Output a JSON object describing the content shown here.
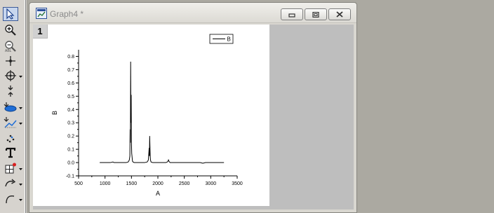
{
  "window": {
    "title": "Graph4 *"
  },
  "layer": {
    "number": "1"
  },
  "tools": [
    {
      "name": "pointer-tool",
      "icon": "pointer-arrow-icon"
    },
    {
      "name": "zoom-in-tool",
      "icon": "zoom-in-icon"
    },
    {
      "name": "zoom-out-tool",
      "icon": "zoom-out-icon"
    },
    {
      "name": "screen-reader-tool",
      "icon": "crosshair-icon"
    },
    {
      "name": "data-reader-tool",
      "icon": "target-icon"
    },
    {
      "name": "data-selector-tool",
      "icon": "selector-icon"
    },
    {
      "name": "draw-data-tool",
      "icon": "draw-data-icon"
    },
    {
      "name": "mask-points-tool",
      "icon": "mask-icon"
    },
    {
      "name": "remove-bad-data-tool",
      "icon": "scatter-dots-icon"
    },
    {
      "name": "text-tool",
      "icon": "text-icon"
    },
    {
      "name": "add-table-tool",
      "icon": "table-icon"
    },
    {
      "name": "arrow-tool",
      "icon": "curved-arrow-icon"
    },
    {
      "name": "curved-arrow-tool",
      "icon": "arc-icon"
    }
  ],
  "chart_data": {
    "type": "line",
    "xlabel": "A",
    "ylabel": "B",
    "xlim": [
      500,
      3500
    ],
    "ylim": [
      -0.1,
      0.85
    ],
    "xticks": [
      500,
      1000,
      1500,
      2000,
      2500,
      3000,
      3500
    ],
    "yticks": [
      -0.1,
      0.0,
      0.1,
      0.2,
      0.3,
      0.4,
      0.5,
      0.6,
      0.7,
      0.8
    ],
    "xtick_labels": [
      "500",
      "1000",
      "1500",
      "2000",
      "2500",
      "3000",
      "3500"
    ],
    "ytick_labels": [
      "-0.1",
      "0.0",
      "0.1",
      "0.2",
      "0.3",
      "0.4",
      "0.5",
      "0.6",
      "0.7",
      "0.8"
    ],
    "legend_position": "top-right",
    "series": [
      {
        "name": "B",
        "color": "#000000",
        "x": [
          900,
          1000,
          1100,
          1150,
          1170,
          1200,
          1300,
          1400,
          1440,
          1460,
          1470,
          1475,
          1480,
          1485,
          1490,
          1495,
          1500,
          1505,
          1510,
          1515,
          1520,
          1530,
          1550,
          1600,
          1650,
          1700,
          1750,
          1800,
          1820,
          1835,
          1840,
          1845,
          1850,
          1855,
          1860,
          1870,
          1900,
          1950,
          2000,
          2100,
          2150,
          2180,
          2190,
          2200,
          2210,
          2230,
          2300,
          2400,
          2500,
          2600,
          2700,
          2800,
          2850,
          2900,
          2950,
          3000,
          3100,
          3200,
          3250
        ],
        "y": [
          0.0,
          0.0,
          0.0,
          0.005,
          0.0,
          0.0,
          0.0,
          0.0,
          0.005,
          0.02,
          0.05,
          0.25,
          0.15,
          0.76,
          0.3,
          0.51,
          0.15,
          0.07,
          0.05,
          0.03,
          0.01,
          0.005,
          0.0,
          0.0,
          0.0,
          0.0,
          0.0,
          0.005,
          0.02,
          0.11,
          0.05,
          0.2,
          0.12,
          0.05,
          0.02,
          0.005,
          0.0,
          0.0,
          0.0,
          0.0,
          0.0,
          0.005,
          0.01,
          0.02,
          0.01,
          0.0,
          0.0,
          0.0,
          0.0,
          0.0,
          0.0,
          0.0,
          -0.005,
          0.0,
          0.0,
          0.0,
          0.0,
          0.0,
          0.0
        ]
      }
    ]
  }
}
